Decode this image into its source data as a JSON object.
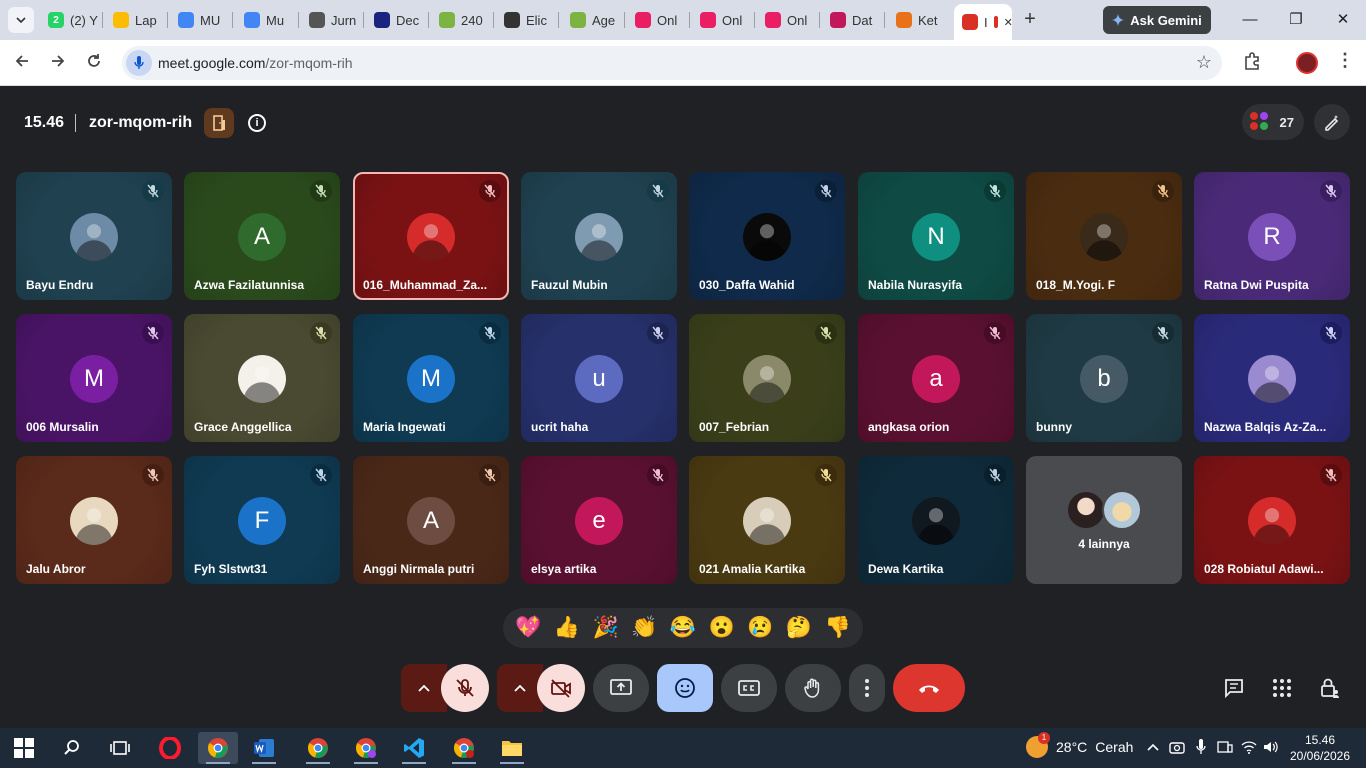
{
  "browser": {
    "tabs": [
      {
        "label": "(2) Y",
        "fav_color": "#25d366",
        "fav_text": "2"
      },
      {
        "label": "Lap",
        "fav_color": "#fbbc04",
        "fav_text": ""
      },
      {
        "label": "MU",
        "fav_color": "#4285f4",
        "fav_text": ""
      },
      {
        "label": "Mu",
        "fav_color": "#4285f4",
        "fav_text": ""
      },
      {
        "label": "Jurn",
        "fav_color": "#555555",
        "fav_text": ""
      },
      {
        "label": "Dec",
        "fav_color": "#1a237e",
        "fav_text": ""
      },
      {
        "label": "240",
        "fav_color": "#7cb342",
        "fav_text": ""
      },
      {
        "label": "Elic",
        "fav_color": "#333333",
        "fav_text": ""
      },
      {
        "label": "Age",
        "fav_color": "#7cb342",
        "fav_text": ""
      },
      {
        "label": "Onl",
        "fav_color": "#e91e63",
        "fav_text": ""
      },
      {
        "label": "Onl",
        "fav_color": "#e91e63",
        "fav_text": ""
      },
      {
        "label": "Onl",
        "fav_color": "#e91e63",
        "fav_text": ""
      },
      {
        "label": "Dat",
        "fav_color": "#c2185b",
        "fav_text": ""
      },
      {
        "label": "Ket",
        "fav_color": "#e8711a",
        "fav_text": ""
      },
      {
        "label": "I",
        "fav_color": "#d93025",
        "fav_text": "",
        "active": true
      }
    ],
    "new_tab": "+",
    "ask_gemini": "Ask Gemini",
    "window_controls": {
      "minimize": "—",
      "restore": "❐",
      "close": "✕"
    },
    "url_host": "meet.google.com",
    "url_path": "/zor-mqom-rih"
  },
  "meet": {
    "time": "15.46",
    "code": "zor-mqom-rih",
    "participant_count": "27",
    "colors": {
      "muted_badge_dark": "#0b57d0",
      "active_border": "#f4b7b2",
      "end_call": "#dc362e"
    },
    "tiles": [
      {
        "name": "Bayu Endru",
        "avatar_type": "photo",
        "avatar_color": "#6d8aa6",
        "bg": "#1f4150",
        "badge": "#153a48",
        "mute_color": "#c4d7e0"
      },
      {
        "name": "Azwa Fazilatunnisa",
        "avatar_type": "letter",
        "letter": "A",
        "avatar_color": "#2e6b2c",
        "bg": "#2a4a1c",
        "badge": "#1f3a14",
        "mute_color": "#c9e0b8"
      },
      {
        "name": "016_Muhammad_Za...",
        "avatar_type": "photo",
        "avatar_color": "#d62b2b",
        "bg": "#7a1214",
        "badge": "#5a0c0e",
        "mute_color": "#f0c0c0",
        "active": true
      },
      {
        "name": "Fauzul Mubin",
        "avatar_type": "photo",
        "avatar_color": "#7f9bb1",
        "bg": "#1f4150",
        "badge": "#153a48",
        "mute_color": "#c4d7e0"
      },
      {
        "name": "030_Daffa Wahid",
        "avatar_type": "photo",
        "avatar_color": "#0a0a0a",
        "bg": "#0f2a4a",
        "badge": "#0a1f38",
        "mute_color": "#c0cfe6"
      },
      {
        "name": "Nabila Nurasyifa",
        "avatar_type": "letter",
        "letter": "N",
        "avatar_color": "#0f8f80",
        "bg": "#0f4a44",
        "badge": "#0b3a35",
        "mute_color": "#bfe3de"
      },
      {
        "name": "018_M.Yogi. F",
        "avatar_type": "photo",
        "avatar_color": "#3a2a1a",
        "bg": "#4a2c10",
        "badge": "#3a220c",
        "mute_color": "#f0c08a"
      },
      {
        "name": "Ratna Dwi Puspita",
        "avatar_type": "letter",
        "letter": "R",
        "avatar_color": "#7b4fb8",
        "bg": "#4a2a78",
        "badge": "#3a1f60",
        "mute_color": "#dccaf0"
      },
      {
        "name": "006 Mursalin",
        "avatar_type": "letter",
        "letter": "M",
        "avatar_color": "#7b1fa2",
        "bg": "#4a1466",
        "badge": "#3a0f52",
        "mute_color": "#e0c4ec"
      },
      {
        "name": "Grace Anggellica",
        "avatar_type": "photo",
        "avatar_color": "#f4f0ea",
        "bg": "#4a4a32",
        "badge": "#3a3a22",
        "mute_color": "#d8e0b0"
      },
      {
        "name": "Maria Ingewati",
        "avatar_type": "letter",
        "letter": "M",
        "avatar_color": "#1a73c8",
        "bg": "#0f3a52",
        "badge": "#0a2c40",
        "mute_color": "#bcd6ea"
      },
      {
        "name": "ucrit haha",
        "avatar_type": "letter",
        "letter": "u",
        "avatar_color": "#5c6bc0",
        "bg": "#26306a",
        "badge": "#1c2452",
        "mute_color": "#cbd0f0"
      },
      {
        "name": "007_Febrian",
        "avatar_type": "photo",
        "avatar_color": "#8a8a6a",
        "bg": "#3a3f1a",
        "badge": "#2c3012",
        "mute_color": "#d8e0a8"
      },
      {
        "name": "angkasa orion",
        "avatar_type": "letter",
        "letter": "a",
        "avatar_color": "#c2185b",
        "bg": "#5a1030",
        "badge": "#460c25",
        "mute_color": "#f0bcd2"
      },
      {
        "name": "bunny",
        "avatar_type": "letter",
        "letter": "b",
        "avatar_color": "#455a64",
        "bg": "#1f3a44",
        "badge": "#162c34",
        "mute_color": "#c4d7e0"
      },
      {
        "name": "Nazwa Balqis Az-Za...",
        "avatar_type": "photo",
        "avatar_color": "#9a8ad0",
        "bg": "#2a2a7a",
        "badge": "#1c1c60",
        "mute_color": "#d0d0f4"
      },
      {
        "name": "Jalu Abror",
        "avatar_type": "photo",
        "avatar_color": "#e8d8c0",
        "bg": "#5a2a1a",
        "badge": "#461f12",
        "mute_color": "#f0c8b8"
      },
      {
        "name": "Fyh Slstwt31",
        "avatar_type": "letter",
        "letter": "F",
        "avatar_color": "#1a73c8",
        "bg": "#0f3a52",
        "badge": "#0a2c40",
        "mute_color": "#bcd6ea"
      },
      {
        "name": "Anggi Nirmala putri",
        "avatar_type": "letter",
        "letter": "A",
        "avatar_color": "#6d4c41",
        "bg": "#4a2818",
        "badge": "#3a1e12",
        "mute_color": "#f0c8b0"
      },
      {
        "name": "elsya artika",
        "avatar_type": "letter",
        "letter": "e",
        "avatar_color": "#c2185b",
        "bg": "#5a1030",
        "badge": "#460c25",
        "mute_color": "#f0bcd2"
      },
      {
        "name": "021 Amalia Kartika",
        "avatar_type": "photo",
        "avatar_color": "#d8cdb8",
        "bg": "#4a3a12",
        "badge": "#3a2c0c",
        "mute_color": "#f0dc98"
      },
      {
        "name": "Dewa Kartika",
        "avatar_type": "photo",
        "avatar_color": "#101820",
        "bg": "#0f2a3a",
        "badge": "#0a1f2c",
        "mute_color": "#bcd0e0"
      },
      {
        "name": "4 lainnya",
        "avatar_type": "more"
      },
      {
        "name": "028 Robiatul Adawi...",
        "avatar_type": "photo",
        "avatar_color": "#d62b2b",
        "bg": "#7a1214",
        "badge": "#5a0c0e",
        "mute_color": "#f0c0c0"
      }
    ],
    "reactions": [
      "💖",
      "👍",
      "🎉",
      "👏",
      "😂",
      "😮",
      "😢",
      "🤔",
      "👎"
    ]
  },
  "taskbar": {
    "weather_temp": "28°C",
    "weather_text": "Cerah",
    "weather_badge": "1",
    "clock_time": "15.46",
    "clock_date": "20/06/2026"
  }
}
